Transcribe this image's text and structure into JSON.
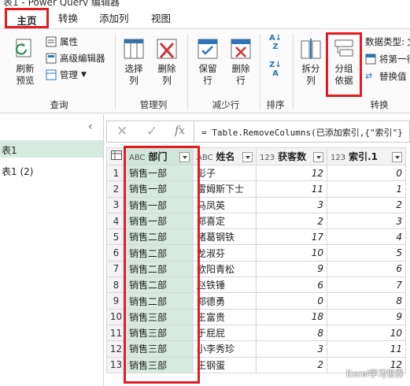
{
  "window": {
    "title": "表1 - Power Query 编辑器"
  },
  "tabs": [
    "主页",
    "转换",
    "添加列",
    "视图"
  ],
  "ribbon": {
    "query": {
      "refresh_line1": "刷新",
      "refresh_line2": "预览",
      "properties": "属性",
      "advanced_editor": "高级编辑器",
      "manage": "管理",
      "label": "查询"
    },
    "manage_cols": {
      "choose_line1": "选择",
      "choose_line2": "列",
      "remove_line1": "删除",
      "remove_line2": "列",
      "label": "管理列"
    },
    "reduce_rows": {
      "keep_line1": "保留",
      "keep_line2": "行",
      "remove_line1": "删除",
      "remove_line2": "行",
      "label": "减少行"
    },
    "sort": {
      "label": "排序"
    },
    "transform": {
      "split_line1": "拆分",
      "split_line2": "列",
      "group_line1": "分组",
      "group_line2": "依据",
      "data_type": "数据类型: 文",
      "first_row": "将第一行",
      "replace": "替换值",
      "label": "转换"
    }
  },
  "nav": {
    "items": [
      "表1",
      "表1 (2)"
    ]
  },
  "formula_bar": {
    "formula": "= Table.RemoveColumns(已添加索引,{\"索引\"}"
  },
  "grid": {
    "columns": [
      {
        "type": "ABC",
        "name": "部门"
      },
      {
        "type": "ABC",
        "name": "姓名"
      },
      {
        "type": "123",
        "name": "获客数"
      },
      {
        "type": "123",
        "name": "索引.1"
      }
    ],
    "rows": [
      [
        "1",
        "销售一部",
        "彭子",
        "12",
        "0"
      ],
      [
        "2",
        "销售一部",
        "雷姆斯下士",
        "11",
        "1"
      ],
      [
        "3",
        "销售一部",
        "马凤英",
        "3",
        "2"
      ],
      [
        "4",
        "销售一部",
        "郑喜定",
        "2",
        "3"
      ],
      [
        "5",
        "销售二部",
        "诸葛钢铁",
        "17",
        "4"
      ],
      [
        "6",
        "销售二部",
        "龙淑芬",
        "10",
        "5"
      ],
      [
        "7",
        "销售二部",
        "欧阳青松",
        "9",
        "6"
      ],
      [
        "8",
        "销售二部",
        "赵铁锤",
        "6",
        "7"
      ],
      [
        "9",
        "销售二部",
        "郑德勇",
        "0",
        "8"
      ],
      [
        "10",
        "销售三部",
        "王富贵",
        "18",
        "9"
      ],
      [
        "11",
        "销售三部",
        "于屁屁",
        "8",
        "10"
      ],
      [
        "12",
        "销售三部",
        "小李秀珍",
        "3",
        "11"
      ],
      [
        "13",
        "销售三部",
        "王钢蛋",
        "2",
        "12"
      ]
    ]
  },
  "watermark": "Excel学习世界",
  "colors": {
    "highlight_red": "#e31c23",
    "selected_green": "#d6eadf"
  }
}
